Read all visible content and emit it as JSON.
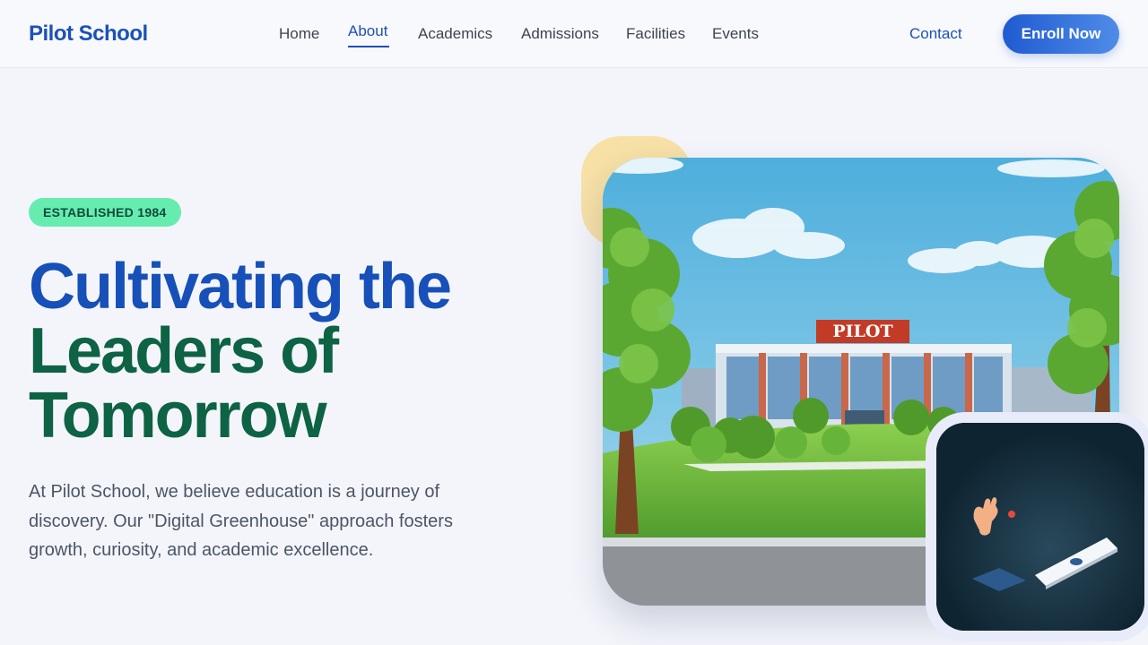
{
  "header": {
    "brand": "Pilot School",
    "nav": [
      "Home",
      "About",
      "Academics",
      "Admissions",
      "Facilities",
      "Events"
    ],
    "active_nav": "About",
    "contact_label": "Contact",
    "enroll_label": "Enroll Now"
  },
  "hero": {
    "badge": "ESTABLISHED 1984",
    "headline_line1": "Cultivating the",
    "headline_line2": "Leaders of",
    "headline_line3": "Tomorrow",
    "description": "At Pilot School, we believe education is a journey of discovery. Our \"Digital Greenhouse\" approach fosters growth, curiosity, and academic excellence.",
    "building_sign": "PILOT"
  },
  "colors": {
    "primary": "#1c51b6",
    "green_heading": "#0d6344",
    "badge_bg": "#67ecb0",
    "deco_yellow": "#f7e1a7"
  }
}
